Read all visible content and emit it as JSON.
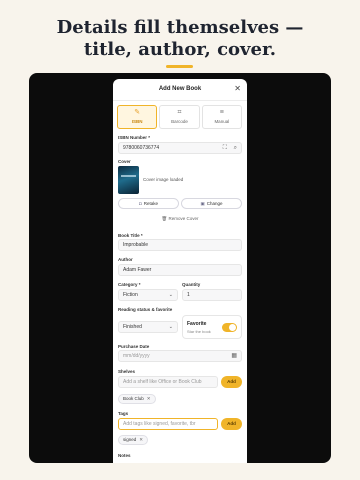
{
  "headline": {
    "line1": "Details fill themselves —",
    "line2": "title, author, cover."
  },
  "modal": {
    "title": "Add New Book",
    "close_icon": "close-icon",
    "modes": [
      {
        "label": "ISBN",
        "icon": "isbn-icon",
        "active": true
      },
      {
        "label": "Barcode",
        "icon": "barcode-icon",
        "active": false
      },
      {
        "label": "Manual",
        "icon": "manual-icon",
        "active": false
      }
    ],
    "isbn": {
      "label": "ISBN Number *",
      "value": "9780060736774"
    },
    "cover": {
      "label": "Cover",
      "status": "Cover image loaded",
      "retake_label": "Retake",
      "change_label": "Change",
      "remove_label": "Remove Cover"
    },
    "book_title": {
      "label": "Book Title *",
      "value": "Improbable"
    },
    "author": {
      "label": "Author",
      "value": "Adam Fawer"
    },
    "category": {
      "label": "Category *",
      "value": "Fiction"
    },
    "quantity": {
      "label": "Quantity",
      "value": "1"
    },
    "reading": {
      "label": "Reading status & favorite",
      "value": "Finished"
    },
    "favorite": {
      "title": "Favorite",
      "subtitle": "Star the book",
      "on": true
    },
    "purchase": {
      "label": "Purchase Date",
      "placeholder": "mm/dd/yyyy"
    },
    "shelves": {
      "label": "Shelves",
      "placeholder": "Add a shelf like Office or Book Club",
      "add_label": "Add",
      "chips": [
        "Book Club"
      ]
    },
    "tags": {
      "label": "Tags",
      "placeholder": "Add tags like signed, favorite, tbr",
      "add_label": "Add",
      "chips": [
        "signed"
      ]
    },
    "notes": {
      "label": "Notes"
    }
  },
  "colors": {
    "accent": "#f0b429",
    "background": "#f8f4ec",
    "device": "#0c0c0c"
  }
}
